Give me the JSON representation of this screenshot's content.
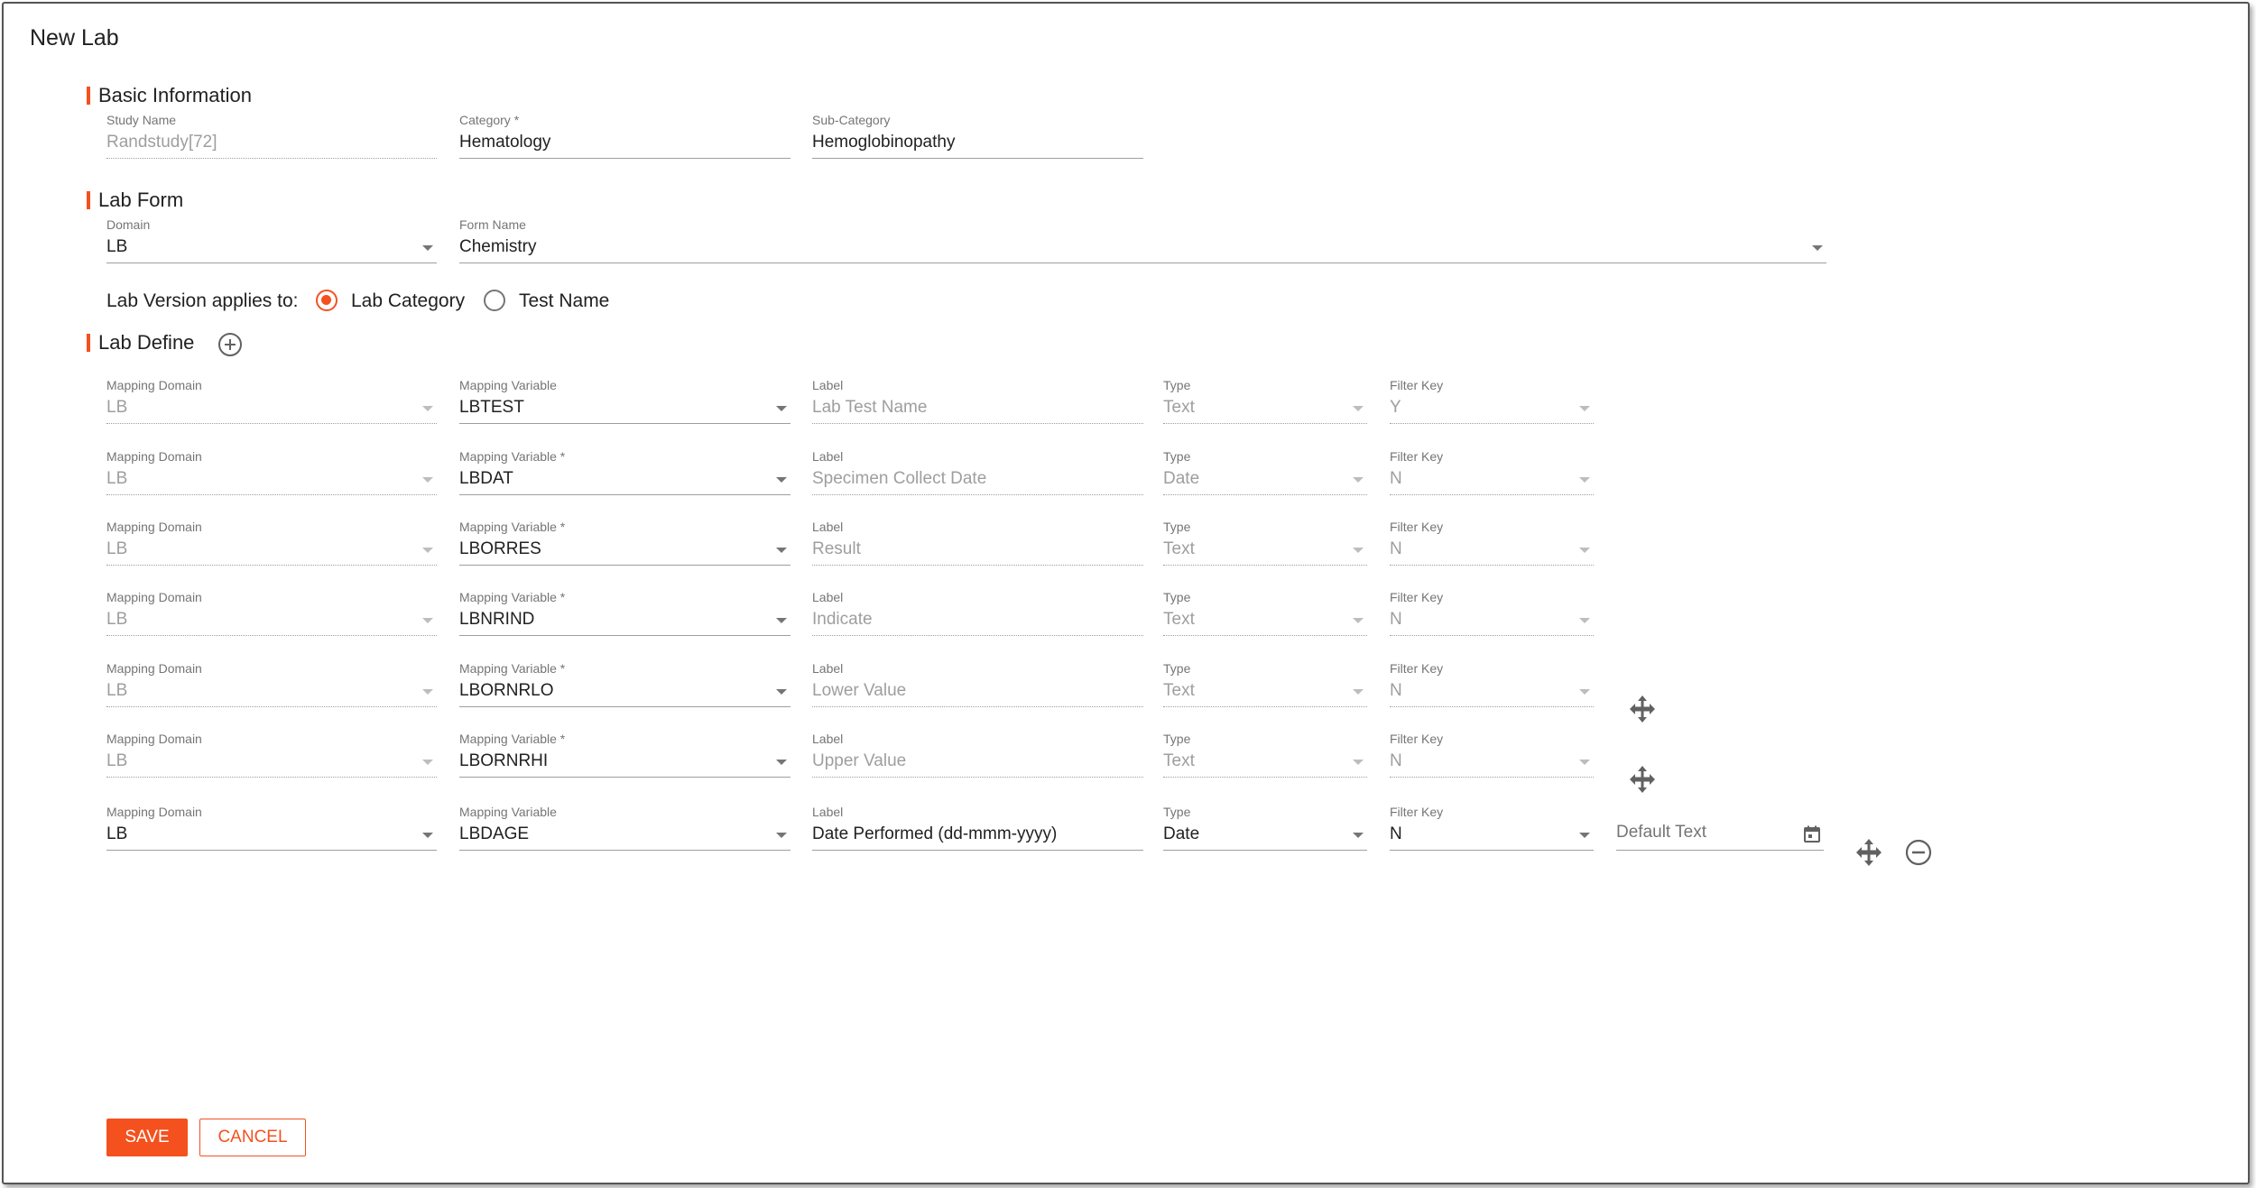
{
  "page": {
    "title": "New Lab"
  },
  "basic_info": {
    "title": "Basic Information",
    "study_name": {
      "label": "Study Name",
      "value": "Randstudy[72]"
    },
    "category": {
      "label": "Category *",
      "value": "Hematology"
    },
    "sub_category": {
      "label": "Sub-Category",
      "value": "Hemoglobinopathy"
    }
  },
  "lab_form": {
    "title": "Lab Form",
    "domain": {
      "label": "Domain",
      "value": "LB"
    },
    "form_name": {
      "label": "Form Name",
      "value": "Chemistry"
    }
  },
  "lab_version": {
    "prompt": "Lab Version applies to:",
    "options": [
      {
        "label": "Lab Category",
        "selected": true
      },
      {
        "label": "Test Name",
        "selected": false
      }
    ]
  },
  "lab_define": {
    "title": "Lab Define",
    "col_labels": {
      "mapping_domain": "Mapping Domain",
      "label": "Label",
      "type": "Type",
      "filter_key": "Filter Key"
    },
    "rows": [
      {
        "domain": "LB",
        "var_label": "Mapping Variable",
        "var": "LBTEST",
        "label": "Lab Test Name",
        "type": "Text",
        "filter": "Y"
      },
      {
        "domain": "LB",
        "var_label": "Mapping Variable *",
        "var": "LBDAT",
        "label": "Specimen Collect Date",
        "type": "Date",
        "filter": "N"
      },
      {
        "domain": "LB",
        "var_label": "Mapping Variable *",
        "var": "LBORRES",
        "label": "Result",
        "type": "Text",
        "filter": "N"
      },
      {
        "domain": "LB",
        "var_label": "Mapping Variable *",
        "var": "LBNRIND",
        "label": "Indicate",
        "type": "Text",
        "filter": "N"
      },
      {
        "domain": "LB",
        "var_label": "Mapping Variable *",
        "var": "LBORNRLO",
        "label": "Lower Value",
        "type": "Text",
        "filter": "N"
      },
      {
        "domain": "LB",
        "var_label": "Mapping Variable *",
        "var": "LBORNRHI",
        "label": "Upper Value",
        "type": "Text",
        "filter": "N"
      },
      {
        "domain": "LB",
        "var_label": "Mapping Variable",
        "var": "LBDAGE",
        "label": "Date Performed (dd-mmm-yyyy)",
        "type": "Date",
        "filter": "N",
        "default_placeholder": "Default Text"
      }
    ]
  },
  "actions": {
    "save": "SAVE",
    "cancel": "CANCEL"
  },
  "colors": {
    "accent": "#f4511e",
    "border": "#555555"
  },
  "icons": [
    "add-circle-icon",
    "move-icon",
    "calendar-icon",
    "remove-circle-icon"
  ]
}
